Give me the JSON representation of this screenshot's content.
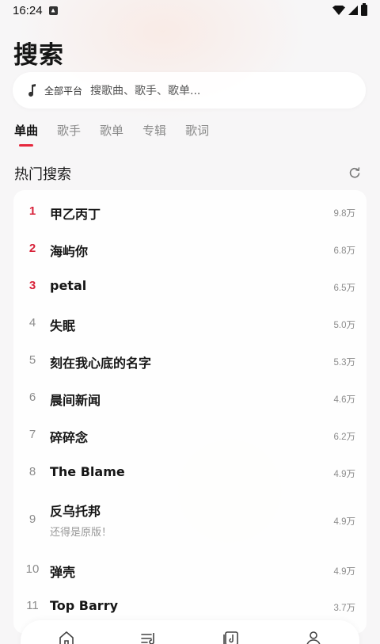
{
  "status": {
    "time": "16:24"
  },
  "page": {
    "title": "搜索"
  },
  "search": {
    "platform": "全部平台",
    "placeholder": "搜歌曲、歌手、歌单..."
  },
  "tabs": [
    "单曲",
    "歌手",
    "歌单",
    "专辑",
    "歌词"
  ],
  "hot": {
    "title": "热门搜索",
    "items": [
      {
        "rank": "1",
        "name": "甲乙丙丁",
        "count": "9.8万"
      },
      {
        "rank": "2",
        "name": "海屿你",
        "count": "6.8万"
      },
      {
        "rank": "3",
        "name": "petal",
        "count": "6.5万"
      },
      {
        "rank": "4",
        "name": "失眠",
        "count": "5.0万"
      },
      {
        "rank": "5",
        "name": "刻在我心底的名字",
        "count": "5.3万"
      },
      {
        "rank": "6",
        "name": "晨间新闻",
        "count": "4.6万"
      },
      {
        "rank": "7",
        "name": "碎碎念",
        "count": "6.2万"
      },
      {
        "rank": "8",
        "name": "The Blame",
        "count": "4.9万"
      },
      {
        "rank": "9",
        "name": "反乌托邦",
        "sub": "还得是原版！",
        "count": "4.9万"
      },
      {
        "rank": "10",
        "name": "弹壳",
        "count": "4.9万"
      },
      {
        "rank": "11",
        "name": "Top Barry",
        "count": "3.7万"
      }
    ]
  },
  "icons": {
    "music_note": "music-note-icon",
    "refresh": "refresh-icon",
    "nav": [
      "home-icon",
      "playlist-icon",
      "music-library-icon",
      "profile-icon"
    ]
  },
  "colors": {
    "accent": "#e6283d",
    "top_rank": "#d8233a"
  }
}
